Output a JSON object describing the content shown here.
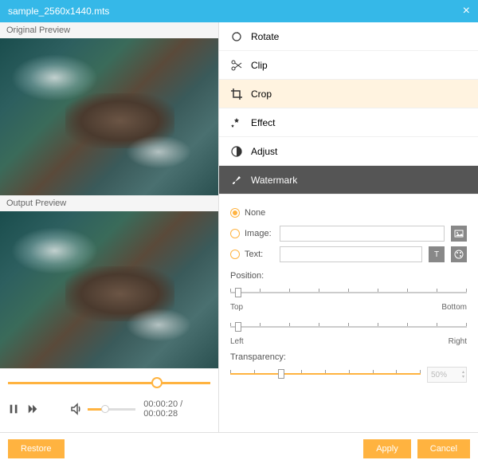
{
  "title": "sample_2560x1440.mts",
  "labels": {
    "original": "Original Preview",
    "output": "Output Preview"
  },
  "playback": {
    "current": "00:00:20",
    "total": "00:00:28",
    "position_pct": 71,
    "volume_pct": 30
  },
  "tools": {
    "rotate": "Rotate",
    "clip": "Clip",
    "crop": "Crop",
    "effect": "Effect",
    "adjust": "Adjust",
    "watermark": "Watermark"
  },
  "watermark": {
    "none": "None",
    "image": "Image:",
    "text": "Text:",
    "image_value": "",
    "text_value": "",
    "position": "Position:",
    "top": "Top",
    "bottom": "Bottom",
    "left": "Left",
    "right": "Right",
    "transparency": "Transparency:",
    "transparency_value": "50%",
    "selected": "none",
    "vpos_pct": 2,
    "hpos_pct": 2,
    "trans_pct": 25
  },
  "buttons": {
    "restore": "Restore",
    "apply": "Apply",
    "cancel": "Cancel"
  }
}
